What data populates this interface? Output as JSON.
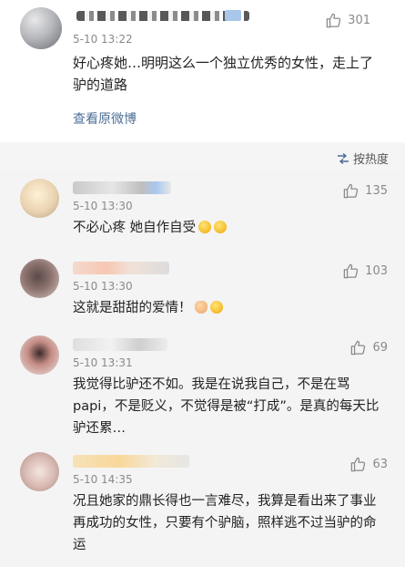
{
  "main_comment": {
    "time": "5-10 13:22",
    "likes": "301",
    "text": "好心疼她…明明这么一个独立优秀的女性，走上了驴的道路",
    "view_original_label": "查看原微博"
  },
  "sort": {
    "label": "按热度",
    "icon": "sort-icon"
  },
  "replies": [
    {
      "time": "5-10 13:30",
      "likes": "135",
      "text": "不必心疼 她自作自受",
      "emojis": [
        "smile-emoji",
        "smile-emoji"
      ]
    },
    {
      "time": "5-10 13:30",
      "likes": "103",
      "text": "这就是甜甜的爱情！",
      "emojis": [
        "thumbs-up-emoji",
        "grin-emoji"
      ]
    },
    {
      "time": "5-10 13:31",
      "likes": "69",
      "text": "我觉得比驴还不如。我是在说我自己，不是在骂papi，不是贬义，不觉得是被“打成”。是真的每天比驴还累…"
    },
    {
      "time": "5-10 14:35",
      "likes": "63",
      "text": "况且她家的鼎长得也一言难尽，我算是看出来了事业再成功的女性，只要有个驴脑，照样逃不过当驴的命运"
    }
  ],
  "colors": {
    "link": "#4e6f98",
    "meta": "#8a8a8a",
    "reply_bg": "#f4f4f4"
  }
}
